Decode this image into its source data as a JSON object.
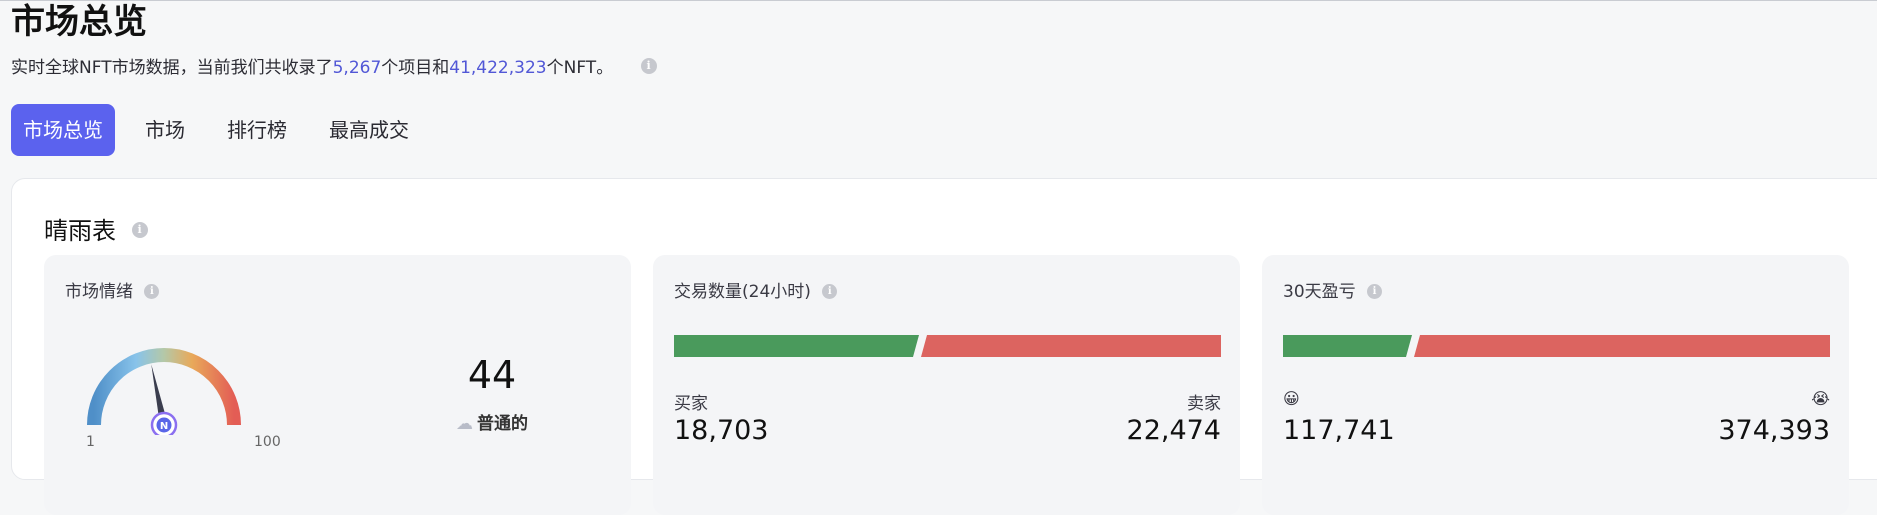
{
  "page": {
    "title": "市场总览",
    "subtitle_prefix": "实时全球NFT市场数据，当前我们共收录了",
    "project_count": "5,267",
    "subtitle_mid": "个项目和",
    "nft_count": "41,422,323",
    "subtitle_suffix": "个NFT。"
  },
  "tabs": [
    {
      "label": "市场总览",
      "active": true
    },
    {
      "label": "市场",
      "active": false
    },
    {
      "label": "排行榜",
      "active": false
    },
    {
      "label": "最高成交",
      "active": false
    }
  ],
  "section": {
    "title": "晴雨表"
  },
  "sentiment": {
    "title": "市场情绪",
    "value": "44",
    "value_number": 44,
    "min": "1",
    "max": "100",
    "label": "普通的",
    "icon": "cloud-icon"
  },
  "volume": {
    "title": "交易数量(24小时)",
    "buyers_label": "买家",
    "buyers": "18,703",
    "buyers_number": 18703,
    "sellers_label": "卖家",
    "sellers": "22,474",
    "sellers_number": 22474
  },
  "pnl": {
    "title": "30天盈亏",
    "profit_icon": "😀",
    "profit": "117,741",
    "profit_number": 117741,
    "loss_icon": "😭",
    "loss": "374,393",
    "loss_number": 374393
  },
  "colors": {
    "accent": "#5b62ee",
    "highlight_number": "#5157d6",
    "green": "#4a9a5c",
    "red": "#dc6460"
  }
}
